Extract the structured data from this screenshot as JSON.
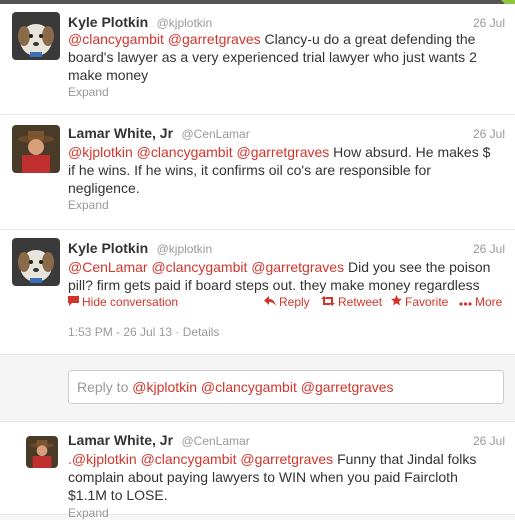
{
  "tweets": [
    {
      "name": "Kyle Plotkin",
      "handle": "@kjplotkin",
      "time": "26 Jul",
      "mentions": "@clancygambit @garretgraves",
      "text": " Clancy-u do a great defending the board's lawyer as a very experienced trial lawyer who just wants 2 make money",
      "expand": "Expand"
    },
    {
      "name": "Lamar White, Jr",
      "handle": "@CenLamar",
      "time": "26 Jul",
      "mentions": "@kjplotkin @clancygambit @garretgraves",
      "text": " How absurd. He makes $ if he wins. If he wins, it confirms oil co's are responsible for negligence.",
      "expand": "Expand"
    },
    {
      "name": "Kyle Plotkin",
      "handle": "@kjplotkin",
      "time": "26 Jul",
      "mentions": "@CenLamar @clancygambit @garretgraves",
      "text": " Did you see the poison pill? firm gets paid if board steps out. they make money regardless",
      "actions": {
        "hide": "Hide conversation",
        "reply": "Reply",
        "retweet": "Retweet",
        "favorite": "Favorite",
        "more": "More"
      },
      "timestamp": "1:53 PM - 26 Jul 13",
      "details": "Details"
    },
    {
      "name": "Lamar White, Jr",
      "handle": "@CenLamar",
      "time": "26 Jul",
      "prefix": ".",
      "mentions": "@kjplotkin @clancygambit @garretgraves",
      "text": " Funny that Jindal folks complain about paying lawyers to WIN when you paid Faircloth $1.1M to LOSE.",
      "expand": "Expand"
    }
  ],
  "reply_box": {
    "prefix": "Reply to ",
    "mentions": "@kjplotkin @clancygambit @garretgraves"
  },
  "colors": {
    "accent": "#d2342b",
    "muted": "#999999"
  }
}
